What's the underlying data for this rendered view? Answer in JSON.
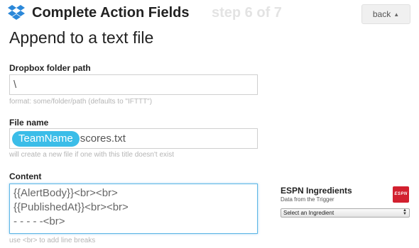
{
  "header": {
    "title": "Complete Action Fields",
    "step": "step 6 of 7",
    "back_label": "back",
    "logo_icon": "dropbox-icon",
    "brand_color": "#007ee5"
  },
  "action": {
    "title": "Append to a text file"
  },
  "fields": {
    "folder": {
      "label": "Dropbox folder path",
      "value": "\\",
      "hint": "format: some/folder/path (defaults to \"IFTTT\")"
    },
    "filename": {
      "label": "File name",
      "token": "TeamName",
      "value": "scores.txt",
      "hint": "will create a new file if one with this title doesn't exist"
    },
    "content": {
      "label": "Content",
      "lines": [
        "{{AlertBody}}<br><br>",
        "{{PublishedAt}}<br><br>",
        "- - - - -<br>"
      ],
      "hint": "use <br> to add line breaks"
    }
  },
  "ingredients": {
    "title": "ESPN Ingredients",
    "subtitle": "Data from the Trigger",
    "logo_text": "ESPN",
    "select_value": "Select an Ingredient",
    "logo_color": "#d2202f"
  },
  "token_color": "#3bbde8"
}
